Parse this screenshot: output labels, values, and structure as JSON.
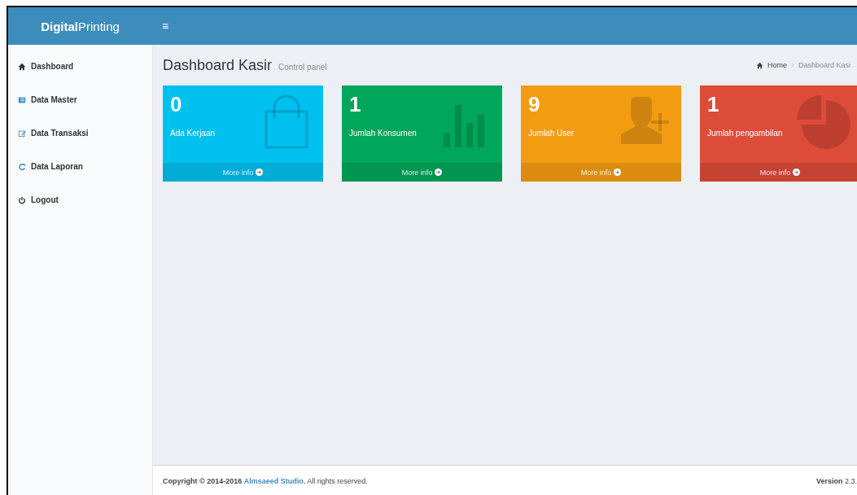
{
  "header": {
    "logo": "**Digital**Printing",
    "menu_toggle": "≡"
  },
  "sidebar": {
    "items": [
      {
        "label": "Dashboard",
        "kind": "home"
      },
      {
        "label": "Data Master",
        "kind": "table"
      },
      {
        "label": "Data Transaksi",
        "kind": "edit"
      },
      {
        "label": "Data Laporan",
        "kind": "refresh"
      },
      {
        "label": "Logout",
        "kind": "power"
      }
    ]
  },
  "page": {
    "title": "Dashboard Kasir",
    "subtitle": "Control panel",
    "breadcrumb": [
      "Home",
      "Dashboard Kasi"
    ]
  },
  "cards": [
    {
      "value": "0",
      "label": "Ada Kerjaan",
      "link": "More info",
      "color": "#00c0ef",
      "kind": "bag"
    },
    {
      "value": "1",
      "label": "Jumlah Konsumen",
      "link": "More info",
      "color": "#00a65a",
      "kind": "bars"
    },
    {
      "value": "9",
      "label": "Jumlah User",
      "link": "More info",
      "color": "#f39c12",
      "kind": "user"
    },
    {
      "value": "1",
      "label": "Jumlah pengambilan",
      "link": "More info",
      "color": "#dd4b39",
      "kind": "pie"
    }
  ],
  "footer": {
    "copyright": "Copyright © 2014-2016",
    "link": "Almsaeed Studio.",
    "rest": "All rights reserved.",
    "version": "**Version** 2.3."
  }
}
